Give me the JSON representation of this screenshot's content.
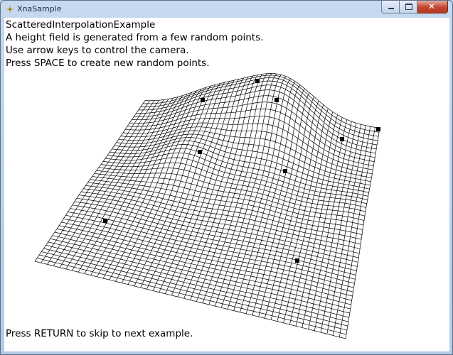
{
  "window": {
    "title": "XnaSample",
    "icon": "xna-app-icon",
    "controls": {
      "minimize": "minimize-icon",
      "maximize": "maximize-icon",
      "close": "close-icon"
    }
  },
  "content": {
    "heading": "ScatteredInterpolationExample",
    "lines": [
      "A height field is generated from a few random points.",
      "Use arrow keys to control the camera.",
      "Press SPACE to create new random points."
    ],
    "footer": "Press RETURN to skip to next example."
  },
  "scene": {
    "grid_lines_per_side": 50,
    "wire_color": "#000000",
    "marker_color": "#000000",
    "background_color": "#ffffff"
  }
}
